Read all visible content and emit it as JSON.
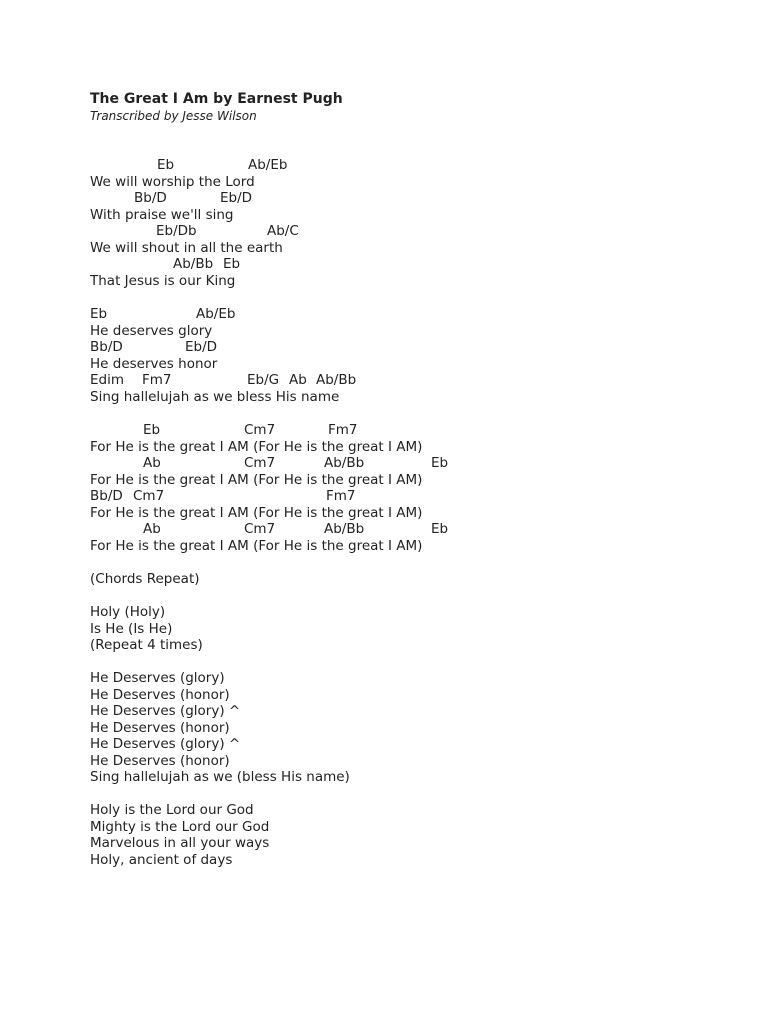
{
  "document": {
    "title": "The Great I Am by Earnest Pugh",
    "subtitle": "Transcribed by Jesse Wilson"
  },
  "verse": {
    "lines": [
      {
        "chords": [
          "Eb",
          "Ab/Eb"
        ],
        "lyric": "We will worship the Lord"
      },
      {
        "chords": [
          "Bb/D",
          "Eb/D"
        ],
        "lyric": "With praise we'll sing"
      },
      {
        "chords": [
          "Eb/Db",
          "Ab/C"
        ],
        "lyric": "We will shout in all the earth"
      },
      {
        "chords": [
          "Ab/Bb",
          "Eb"
        ],
        "lyric": "That Jesus is our King"
      }
    ]
  },
  "prechorus": {
    "lines": [
      {
        "chords": [
          "Eb",
          "Ab/Eb"
        ],
        "lyric": "He deserves glory"
      },
      {
        "chords": [
          "Bb/D",
          "Eb/D"
        ],
        "lyric": "He deserves honor"
      },
      {
        "chords": [
          "Edim",
          "Fm7",
          "Eb/G",
          "Ab",
          "Ab/Bb"
        ],
        "lyric": "Sing hallelujah as we bless His name"
      }
    ]
  },
  "chorus": {
    "lines": [
      {
        "chords": [
          "Eb",
          "Cm7",
          "Fm7"
        ],
        "lyric": "For He is the great I AM (For He is the great I AM)"
      },
      {
        "chords": [
          "Ab",
          "Cm7",
          "Ab/Bb",
          "Eb"
        ],
        "lyric": "For He is the great I AM (For He is the great I AM)"
      },
      {
        "chords": [
          "Bb/D",
          "Cm7",
          "Fm7"
        ],
        "lyric": "For He is the great I AM (For He is the great I AM)"
      },
      {
        "chords": [
          "Ab",
          "Cm7",
          "Ab/Bb",
          "Eb"
        ],
        "lyric": "For He is the great I AM (For He is the great I AM)"
      }
    ]
  },
  "note_chords_repeat": "(Chords Repeat)",
  "holy_section": [
    "Holy (Holy)",
    "Is He (Is He)",
    "(Repeat 4 times)"
  ],
  "deserves_section": [
    "He Deserves (glory)",
    "He Deserves (honor)",
    "He Deserves (glory) ^",
    "He Deserves (honor)",
    "He Deserves (glory) ^",
    "He Deserves (honor)",
    "Sing hallelujah as we (bless His name)"
  ],
  "bridge": [
    "Holy is the Lord our God",
    "Mighty is the Lord our God",
    "Marvelous in all your ways",
    "Holy, ancient of days"
  ]
}
